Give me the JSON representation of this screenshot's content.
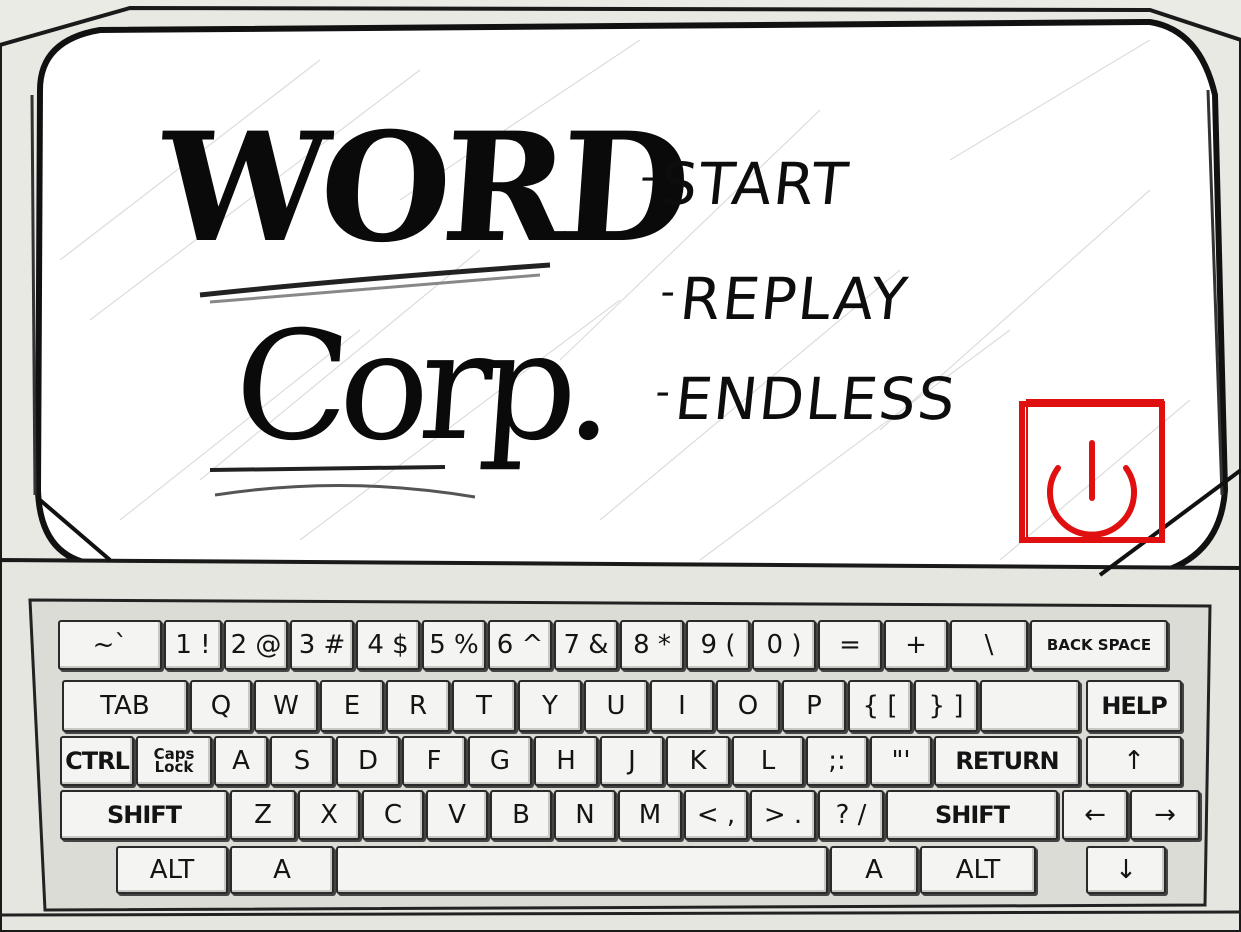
{
  "title": {
    "line1": "WORD",
    "line2": "Corp."
  },
  "menu": [
    {
      "label": "START"
    },
    {
      "label": "REPLAY"
    },
    {
      "label": "ENDLESS"
    }
  ],
  "power_color": "#e01010",
  "keyboard": {
    "row1": [
      "~`",
      "1 !",
      "2 @",
      "3 #",
      "4 $",
      "5 %",
      "6 ^",
      "7 &",
      "8 *",
      "9 (",
      "0 )",
      "=",
      "+",
      "\\",
      "BACK SPACE"
    ],
    "row2": [
      "TAB",
      "Q",
      "W",
      "E",
      "R",
      "T",
      "Y",
      "U",
      "I",
      "O",
      "P",
      "{ [",
      "} ]",
      "",
      "HELP"
    ],
    "row3": [
      "CTRL",
      "Caps Lock",
      "A",
      "S",
      "D",
      "F",
      "G",
      "H",
      "J",
      "K",
      "L",
      ";:",
      "\"'",
      "RETURN",
      "↑"
    ],
    "row4": [
      "SHIFT",
      "Z",
      "X",
      "C",
      "V",
      "B",
      "N",
      "M",
      "< ,",
      "> .",
      "? /",
      "SHIFT",
      "←",
      "→"
    ],
    "row5": [
      "ALT",
      "A",
      "",
      "A",
      "ALT",
      "↓"
    ]
  }
}
